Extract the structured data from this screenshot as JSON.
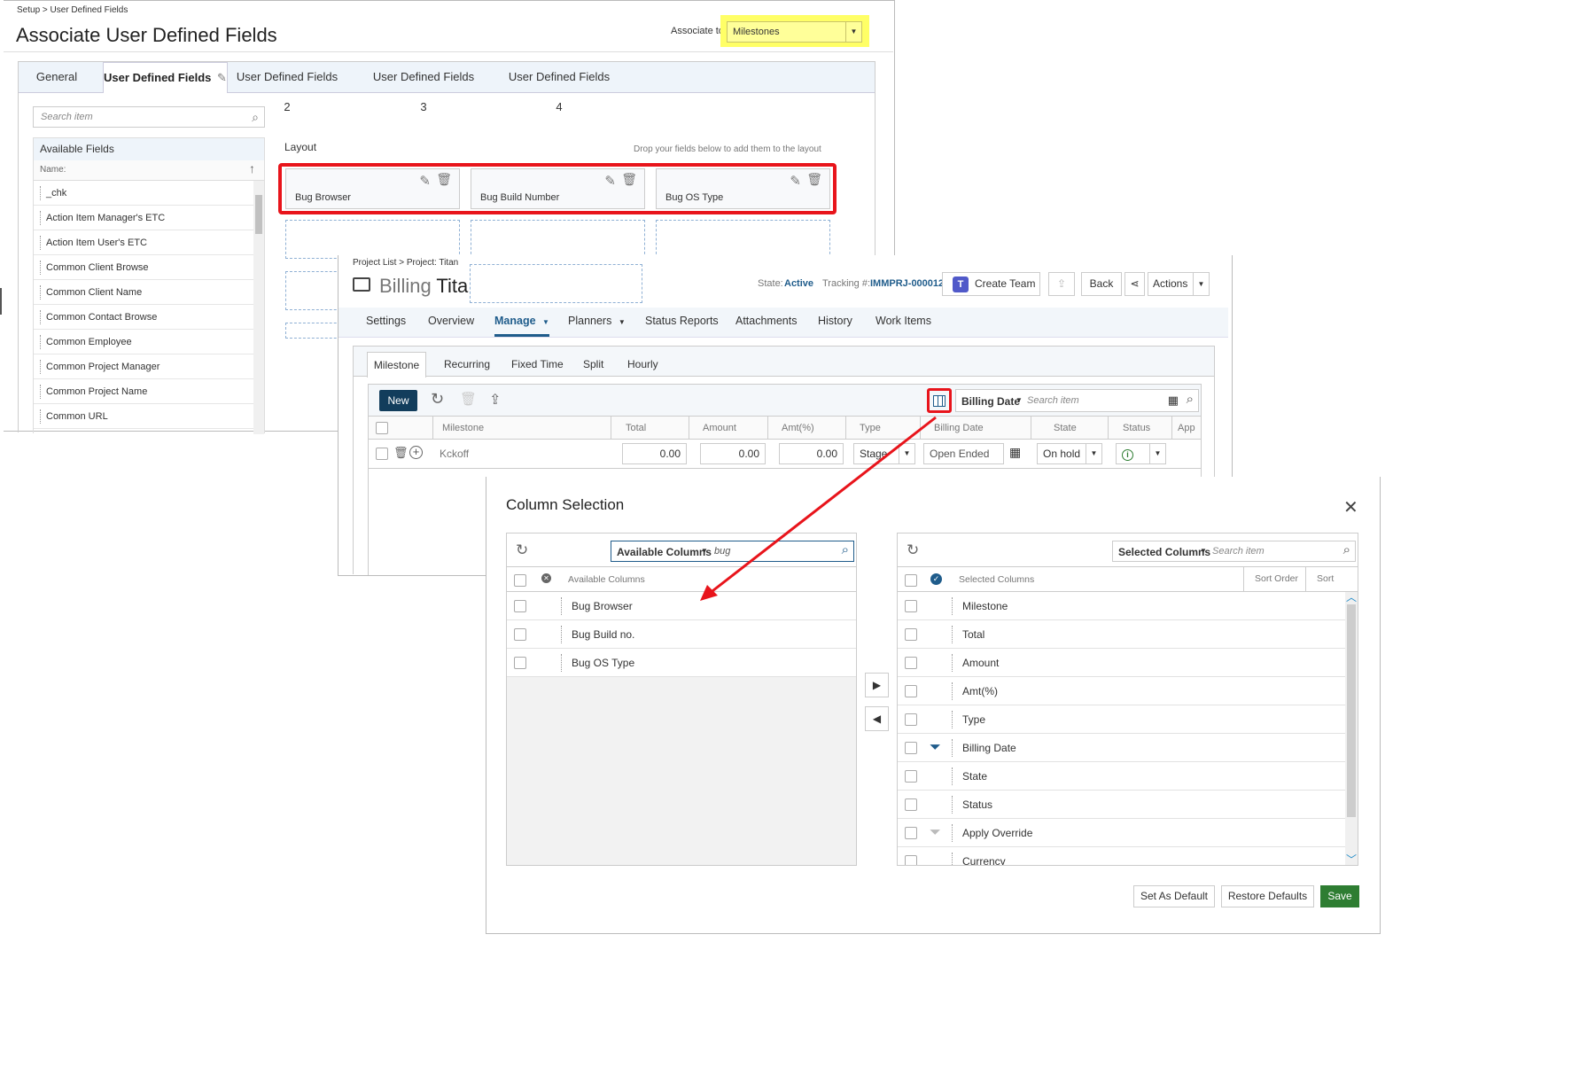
{
  "setup": {
    "breadcrumb": "Setup > User Defined Fields",
    "title": "Associate User Defined Fields",
    "associate_label": "Associate to:",
    "associate_value": "Milestones",
    "tabs": [
      "General",
      "User Defined Fields",
      "User Defined Fields 2",
      "User Defined Fields 3",
      "User Defined Fields 4"
    ],
    "search_placeholder": "Search item",
    "available_fields_title": "Available Fields",
    "name_header": "Name:",
    "fields": [
      "_chk",
      "Action Item Manager's ETC",
      "Action Item User's ETC",
      "Common Client Browse",
      "Common Client Name",
      "Common Contact Browse",
      "Common Employee",
      "Common Project Manager",
      "Common Project Name",
      "Common URL"
    ],
    "layout_label": "Layout",
    "drop_hint": "Drop your fields below to add them to the layout",
    "layout_cards": [
      "Bug Browser",
      "Bug Build Number",
      "Bug OS Type"
    ]
  },
  "project": {
    "breadcrumb": "Project List > Project: Titan",
    "title_prefix": "Billing",
    "title_name": "Tita",
    "state_label": "State:",
    "state_value": "Active",
    "tracking_label": "Tracking #:",
    "tracking_value": "IMMPRJ-000012",
    "create_team": "Create Team",
    "back": "Back",
    "actions": "Actions",
    "nav": [
      "Settings",
      "Overview",
      "Manage",
      "Planners",
      "Status Reports",
      "Attachments",
      "History",
      "Work Items"
    ],
    "subtabs": [
      "Milestone",
      "Recurring",
      "Fixed Time",
      "Split",
      "Hourly"
    ],
    "new_button": "New",
    "billing_date_select": "Billing Date",
    "search_placeholder": "Search item",
    "columns": [
      "Milestone",
      "Total",
      "Amount",
      "Amt(%)",
      "Type",
      "Billing Date",
      "State",
      "Status",
      "App"
    ],
    "row": {
      "milestone": "Kckoff",
      "total": "0.00",
      "amount": "0.00",
      "amt_pct": "0.00",
      "type": "Stage",
      "billing_date": "Open Ended",
      "state": "On hold"
    }
  },
  "dialog": {
    "title": "Column Selection",
    "left_select": "Available Columns",
    "left_search_value": "bug",
    "left_header": "Available Columns",
    "available": [
      "Bug Browser",
      "Bug Build no.",
      "Bug OS Type"
    ],
    "right_select": "Selected Columns",
    "right_search_placeholder": "Search item",
    "right_header": "Selected Columns",
    "sort_order_header": "Sort Order",
    "sort_header": "Sort",
    "selected": [
      "Milestone",
      "Total",
      "Amount",
      "Amt(%)",
      "Type",
      "Billing Date",
      "State",
      "Status",
      "Apply Override",
      "Currency"
    ],
    "set_default": "Set As Default",
    "restore_defaults": "Restore Defaults",
    "save": "Save"
  },
  "colors": {
    "accent": "#1f5c8b",
    "highlight_yellow": "#ffff99",
    "annotation_red": "#e8141b",
    "save_green": "#2e7d32",
    "dark_button": "#123d5c"
  }
}
